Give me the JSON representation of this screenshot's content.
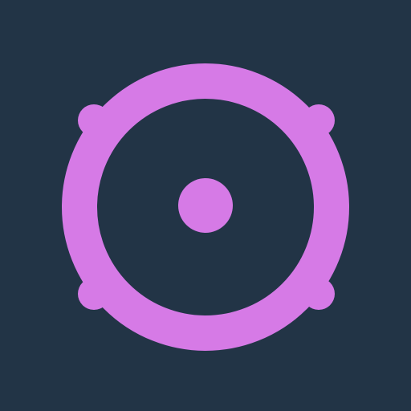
{
  "colors": {
    "background": "#223446",
    "accent": "#D67AE6"
  },
  "icon": {
    "name": "target-icon"
  }
}
